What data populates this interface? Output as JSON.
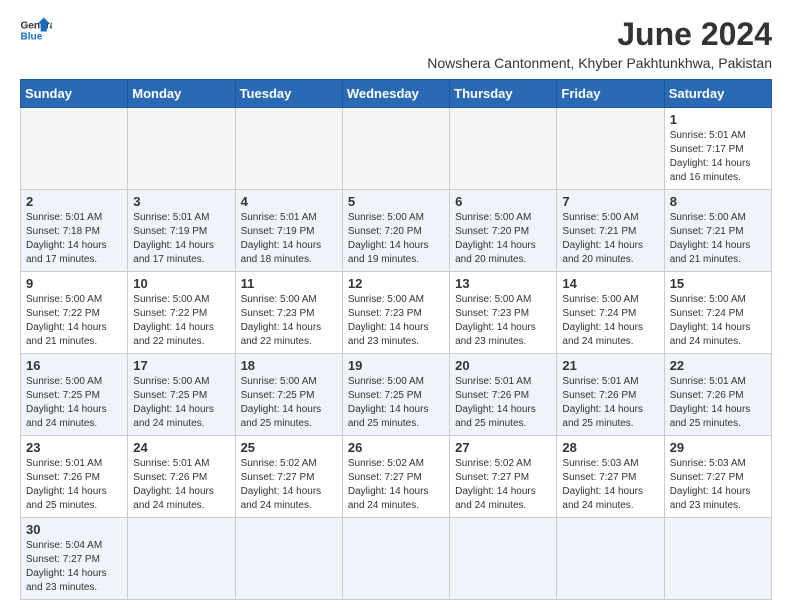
{
  "logo": {
    "line1": "General",
    "line2": "Blue"
  },
  "title": "June 2024",
  "subtitle": "Nowshera Cantonment, Khyber Pakhtunkhwa, Pakistan",
  "weekdays": [
    "Sunday",
    "Monday",
    "Tuesday",
    "Wednesday",
    "Thursday",
    "Friday",
    "Saturday"
  ],
  "weeks": [
    [
      {
        "day": "",
        "info": ""
      },
      {
        "day": "",
        "info": ""
      },
      {
        "day": "",
        "info": ""
      },
      {
        "day": "",
        "info": ""
      },
      {
        "day": "",
        "info": ""
      },
      {
        "day": "",
        "info": ""
      },
      {
        "day": "1",
        "info": "Sunrise: 5:01 AM\nSunset: 7:17 PM\nDaylight: 14 hours\nand 16 minutes."
      }
    ],
    [
      {
        "day": "2",
        "info": "Sunrise: 5:01 AM\nSunset: 7:18 PM\nDaylight: 14 hours\nand 17 minutes."
      },
      {
        "day": "3",
        "info": "Sunrise: 5:01 AM\nSunset: 7:19 PM\nDaylight: 14 hours\nand 17 minutes."
      },
      {
        "day": "4",
        "info": "Sunrise: 5:01 AM\nSunset: 7:19 PM\nDaylight: 14 hours\nand 18 minutes."
      },
      {
        "day": "5",
        "info": "Sunrise: 5:00 AM\nSunset: 7:20 PM\nDaylight: 14 hours\nand 19 minutes."
      },
      {
        "day": "6",
        "info": "Sunrise: 5:00 AM\nSunset: 7:20 PM\nDaylight: 14 hours\nand 20 minutes."
      },
      {
        "day": "7",
        "info": "Sunrise: 5:00 AM\nSunset: 7:21 PM\nDaylight: 14 hours\nand 20 minutes."
      },
      {
        "day": "8",
        "info": "Sunrise: 5:00 AM\nSunset: 7:21 PM\nDaylight: 14 hours\nand 21 minutes."
      }
    ],
    [
      {
        "day": "9",
        "info": "Sunrise: 5:00 AM\nSunset: 7:22 PM\nDaylight: 14 hours\nand 21 minutes."
      },
      {
        "day": "10",
        "info": "Sunrise: 5:00 AM\nSunset: 7:22 PM\nDaylight: 14 hours\nand 22 minutes."
      },
      {
        "day": "11",
        "info": "Sunrise: 5:00 AM\nSunset: 7:23 PM\nDaylight: 14 hours\nand 22 minutes."
      },
      {
        "day": "12",
        "info": "Sunrise: 5:00 AM\nSunset: 7:23 PM\nDaylight: 14 hours\nand 23 minutes."
      },
      {
        "day": "13",
        "info": "Sunrise: 5:00 AM\nSunset: 7:23 PM\nDaylight: 14 hours\nand 23 minutes."
      },
      {
        "day": "14",
        "info": "Sunrise: 5:00 AM\nSunset: 7:24 PM\nDaylight: 14 hours\nand 24 minutes."
      },
      {
        "day": "15",
        "info": "Sunrise: 5:00 AM\nSunset: 7:24 PM\nDaylight: 14 hours\nand 24 minutes."
      }
    ],
    [
      {
        "day": "16",
        "info": "Sunrise: 5:00 AM\nSunset: 7:25 PM\nDaylight: 14 hours\nand 24 minutes."
      },
      {
        "day": "17",
        "info": "Sunrise: 5:00 AM\nSunset: 7:25 PM\nDaylight: 14 hours\nand 24 minutes."
      },
      {
        "day": "18",
        "info": "Sunrise: 5:00 AM\nSunset: 7:25 PM\nDaylight: 14 hours\nand 25 minutes."
      },
      {
        "day": "19",
        "info": "Sunrise: 5:00 AM\nSunset: 7:25 PM\nDaylight: 14 hours\nand 25 minutes."
      },
      {
        "day": "20",
        "info": "Sunrise: 5:01 AM\nSunset: 7:26 PM\nDaylight: 14 hours\nand 25 minutes."
      },
      {
        "day": "21",
        "info": "Sunrise: 5:01 AM\nSunset: 7:26 PM\nDaylight: 14 hours\nand 25 minutes."
      },
      {
        "day": "22",
        "info": "Sunrise: 5:01 AM\nSunset: 7:26 PM\nDaylight: 14 hours\nand 25 minutes."
      }
    ],
    [
      {
        "day": "23",
        "info": "Sunrise: 5:01 AM\nSunset: 7:26 PM\nDaylight: 14 hours\nand 25 minutes."
      },
      {
        "day": "24",
        "info": "Sunrise: 5:01 AM\nSunset: 7:26 PM\nDaylight: 14 hours\nand 24 minutes."
      },
      {
        "day": "25",
        "info": "Sunrise: 5:02 AM\nSunset: 7:27 PM\nDaylight: 14 hours\nand 24 minutes."
      },
      {
        "day": "26",
        "info": "Sunrise: 5:02 AM\nSunset: 7:27 PM\nDaylight: 14 hours\nand 24 minutes."
      },
      {
        "day": "27",
        "info": "Sunrise: 5:02 AM\nSunset: 7:27 PM\nDaylight: 14 hours\nand 24 minutes."
      },
      {
        "day": "28",
        "info": "Sunrise: 5:03 AM\nSunset: 7:27 PM\nDaylight: 14 hours\nand 24 minutes."
      },
      {
        "day": "29",
        "info": "Sunrise: 5:03 AM\nSunset: 7:27 PM\nDaylight: 14 hours\nand 23 minutes."
      }
    ],
    [
      {
        "day": "30",
        "info": "Sunrise: 5:04 AM\nSunset: 7:27 PM\nDaylight: 14 hours\nand 23 minutes."
      },
      {
        "day": "",
        "info": ""
      },
      {
        "day": "",
        "info": ""
      },
      {
        "day": "",
        "info": ""
      },
      {
        "day": "",
        "info": ""
      },
      {
        "day": "",
        "info": ""
      },
      {
        "day": "",
        "info": ""
      }
    ]
  ],
  "shaded_rows": [
    1,
    3,
    5
  ],
  "accent_color": "#2a6ab5"
}
